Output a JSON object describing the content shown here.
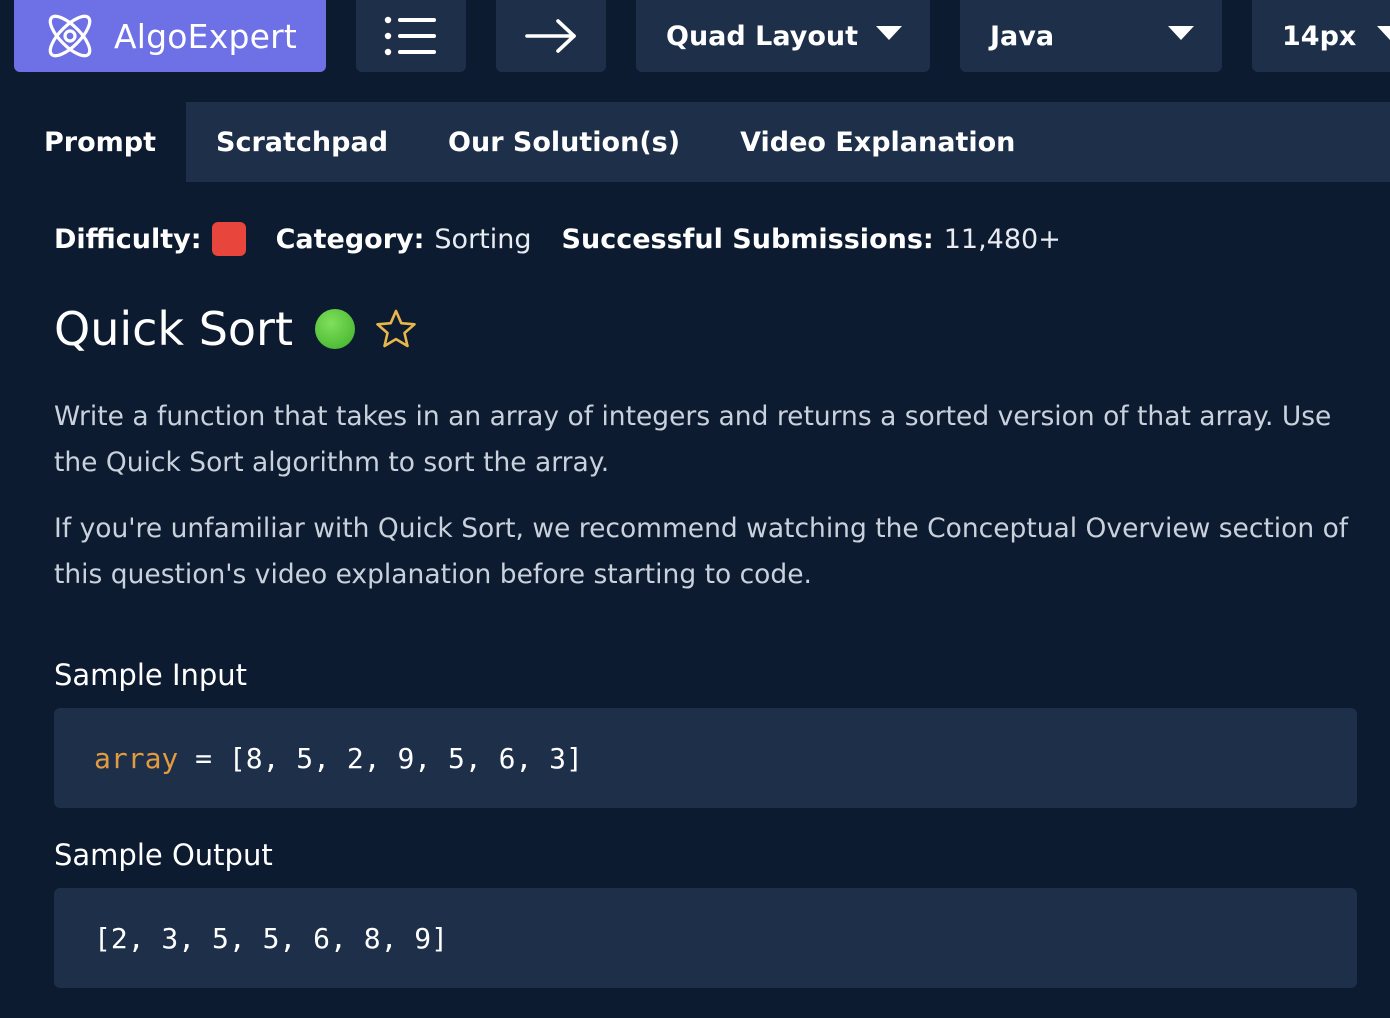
{
  "brand": {
    "name": "AlgoExpert",
    "color": "#6e70e6"
  },
  "toolbar": {
    "menu_icon": "list-icon",
    "next_icon": "arrow-right-icon",
    "layout_select": "Quad Layout",
    "language_select": "Java",
    "font_size_select": "14px"
  },
  "tabs": [
    {
      "label": "Prompt",
      "active": true
    },
    {
      "label": "Scratchpad",
      "active": false
    },
    {
      "label": "Our Solution(s)",
      "active": false
    },
    {
      "label": "Video Explanation",
      "active": false
    }
  ],
  "meta": {
    "difficulty_label": "Difficulty:",
    "difficulty_color": "#e8453c",
    "category_label": "Category:",
    "category_value": "Sorting",
    "submissions_label": "Successful Submissions:",
    "submissions_value": "11,480+"
  },
  "question": {
    "title": "Quick Sort",
    "status_color": "#4cc23a",
    "favorite_icon": "star-outline-icon",
    "paragraphs": [
      "Write a function that takes in an array of integers and returns a sorted version of that array. Use the Quick Sort algorithm to sort the array.",
      "If you're unfamiliar with Quick Sort, we recommend watching the Conceptual Overview section of this question's video explanation before starting to code."
    ]
  },
  "sample_input": {
    "heading": "Sample Input",
    "var_name": "array",
    "operator": " = ",
    "value": "[8, 5, 2, 9, 5, 6, 3]"
  },
  "sample_output": {
    "heading": "Sample Output",
    "value": "[2, 3, 5, 5, 6, 8, 9]"
  }
}
